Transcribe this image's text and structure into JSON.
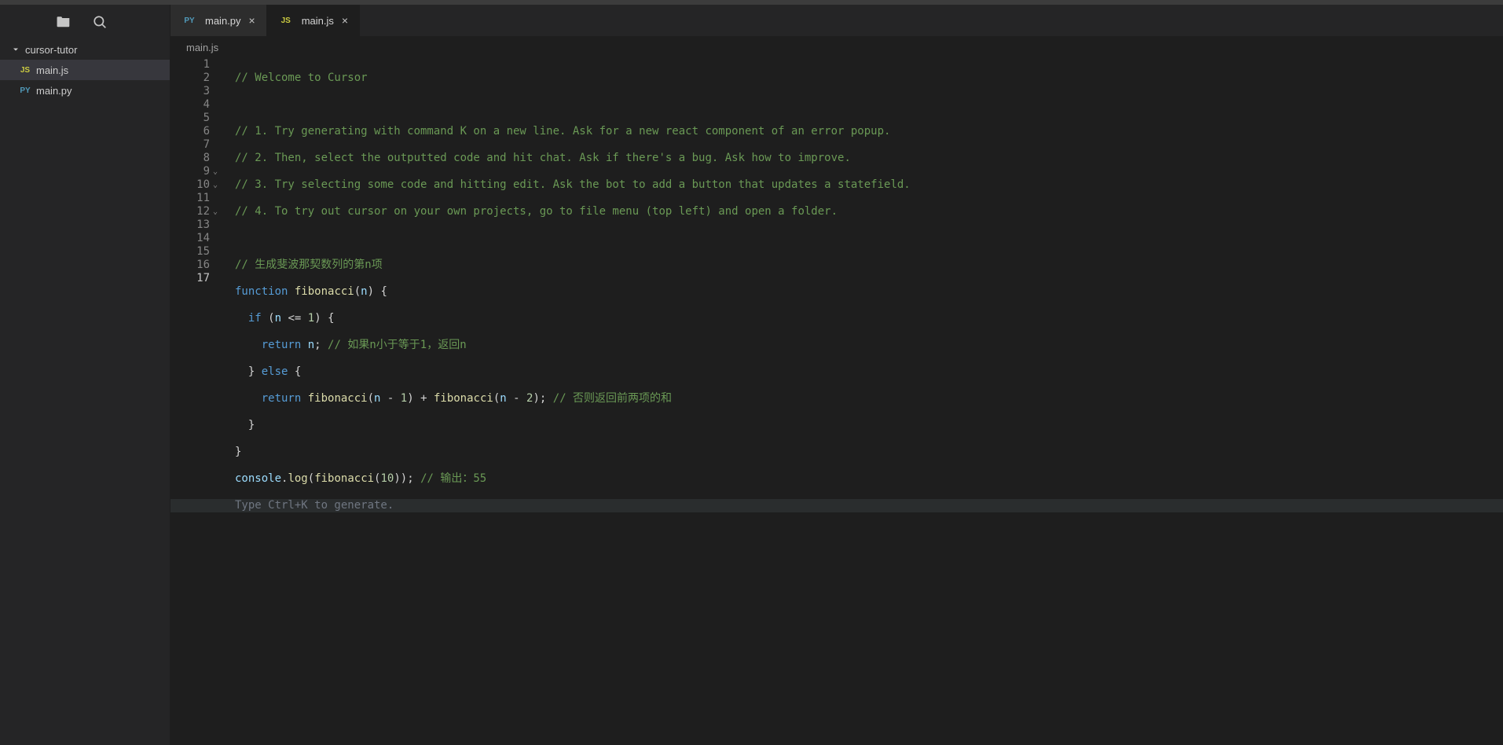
{
  "sidebar": {
    "folder": "cursor-tutor",
    "files": [
      {
        "icon": "JS",
        "iconClass": "js",
        "name": "main.js",
        "active": true
      },
      {
        "icon": "PY",
        "iconClass": "py",
        "name": "main.py",
        "active": false
      }
    ]
  },
  "tabs": [
    {
      "icon": "PY",
      "iconClass": "py",
      "name": "main.py",
      "active": false
    },
    {
      "icon": "JS",
      "iconClass": "js",
      "name": "main.js",
      "active": true
    }
  ],
  "breadcrumb": "main.js",
  "lineNumbers": [
    "1",
    "2",
    "3",
    "4",
    "5",
    "6",
    "7",
    "8",
    "9",
    "10",
    "11",
    "12",
    "13",
    "14",
    "15",
    "16",
    "17"
  ],
  "foldLines": [
    9,
    10,
    12
  ],
  "activeLine": 17,
  "code": {
    "l1": "// Welcome to Cursor",
    "l3": "// 1. Try generating with command K on a new line. Ask for a new react component of an error popup.",
    "l4": "// 2. Then, select the outputted code and hit chat. Ask if there's a bug. Ask how to improve.",
    "l5": "// 3. Try selecting some code and hitting edit. Ask the bot to add a button that updates a statefield.",
    "l6": "// 4. To try out cursor on your own projects, go to file menu (top left) and open a folder.",
    "l8": "// 生成斐波那契数列的第n项",
    "l9_function": "function",
    "l9_name": "fibonacci",
    "l9_param": "n",
    "l10_if": "if",
    "l10_n": "n",
    "l10_op": "<=",
    "l10_num": "1",
    "l11_return": "return",
    "l11_n": "n",
    "l11_comment": "// 如果n小于等于1，返回n",
    "l12_else": "else",
    "l13_return": "return",
    "l13_fib1": "fibonacci",
    "l13_n1": "n",
    "l13_minus1": "-",
    "l13_one": "1",
    "l13_plus": "+",
    "l13_fib2": "fibonacci",
    "l13_n2": "n",
    "l13_minus2": "-",
    "l13_two": "2",
    "l13_comment": "// 否则返回前两项的和",
    "l16_console": "console",
    "l16_log": "log",
    "l16_fib": "fibonacci",
    "l16_arg": "10",
    "l16_comment": "// 输出：55",
    "l17_hint": "Type Ctrl+K to generate."
  }
}
